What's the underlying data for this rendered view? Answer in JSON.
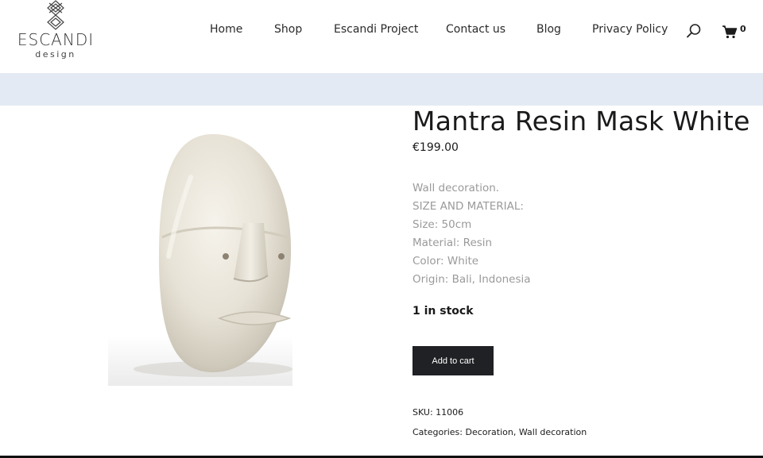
{
  "header": {
    "logo": {
      "brand": "ESCANDI",
      "sub": "design"
    },
    "nav": [
      {
        "label": "Home",
        "name": "nav-home"
      },
      {
        "label": "Shop",
        "name": "nav-shop"
      },
      {
        "label": "Escandi Project",
        "name": "nav-escandi-project"
      },
      {
        "label": "Contact us",
        "name": "nav-contact-us"
      },
      {
        "label": "Blog",
        "name": "nav-blog"
      },
      {
        "label": "Privacy Policy",
        "name": "nav-privacy-policy"
      }
    ],
    "search_icon": "search-icon",
    "cart": {
      "icon": "cart-icon",
      "count": "0"
    }
  },
  "colors": {
    "banner": "#e4eaf3",
    "button_bg": "#1f2124",
    "muted_text": "#9a9a9a"
  },
  "product": {
    "title": "Mantra Resin Mask White",
    "price": "€199.00",
    "description": [
      "Wall decoration.",
      "SIZE AND MATERIAL:",
      "Size: 50cm",
      "Material: Resin",
      "Color: White",
      "Origin: Bali, Indonesia"
    ],
    "stock": "1 in stock",
    "add_to_cart": "Add to cart",
    "sku_label": "SKU:",
    "sku_value": "11006",
    "categories_label": "Categories:",
    "categories": [
      "Decoration",
      "Wall decoration"
    ]
  }
}
